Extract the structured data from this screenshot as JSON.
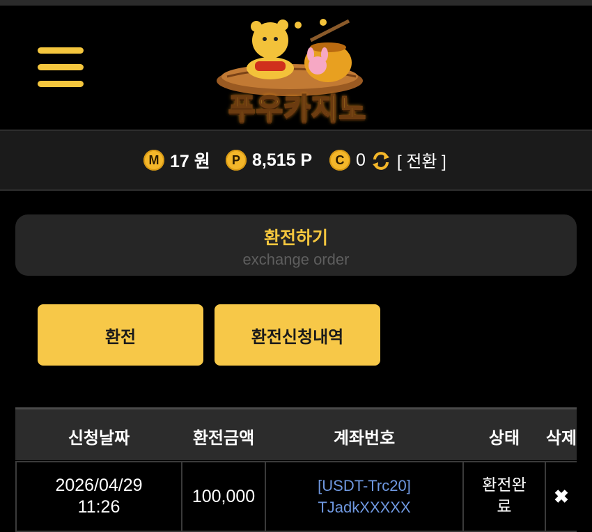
{
  "header": {
    "logo_text": "푸우카지노",
    "menu_icon": "hamburger-menu-icon"
  },
  "balance": {
    "money_symbol": "M",
    "money": "17 원",
    "point_symbol": "P",
    "point": "8,515 P",
    "coin_symbol": "C",
    "coin": "0",
    "convert_label": "[ 전환 ]"
  },
  "title": {
    "main": "환전하기",
    "sub": "exchange order"
  },
  "tabs": {
    "exchange": "환전",
    "history": "환전신청내역"
  },
  "table": {
    "columns": [
      "신청날짜",
      "환전금액",
      "계좌번호",
      "상태",
      "삭제"
    ],
    "rows": [
      {
        "date": "2026/04/29",
        "time": "11:26",
        "amount": "100,000",
        "account_line1": "[USDT-Trc20]",
        "account_line2": "TJadkXXXXX",
        "status_line1": "환전완",
        "status_line2": "료",
        "delete": "✖"
      }
    ]
  },
  "colors": {
    "accent": "#f4c63e",
    "button": "#f7c848",
    "link": "#6f98e0",
    "panel": "#262626"
  }
}
